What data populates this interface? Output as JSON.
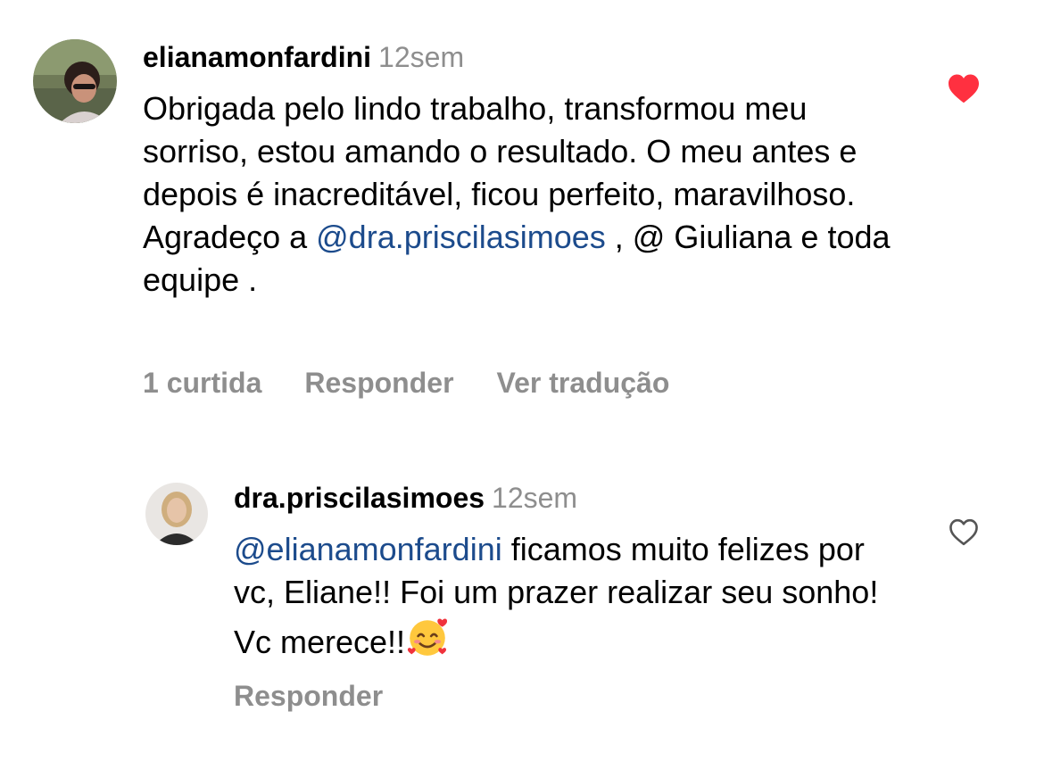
{
  "comments": [
    {
      "username": "elianamonfardini",
      "time": "12sem",
      "text_before": "Obrigada pelo lindo trabalho, transformou meu sorriso, estou amando o resultado. O meu antes e depois é inacreditável, ficou perfeito, maravilhoso. Agradeço a ",
      "mention": "@dra.priscilasimoes",
      "text_after": " , @ Giuliana e toda equipe .",
      "likes": "1 curtida",
      "reply": "Responder",
      "translate": "Ver tradução",
      "liked": true,
      "like_color": "#ff3040",
      "like_icon": "heart-filled-icon"
    },
    {
      "username": "dra.priscilasimoes",
      "time": "12sem",
      "mention": "@elianamonfardini",
      "text_after": " ficamos muito felizes por vc, Eliane!! Foi um prazer realizar seu sonho! Vc merece!!",
      "emoji": "smiling-face-with-hearts-emoji",
      "reply": "Responder",
      "liked": false,
      "like_icon": "heart-outline-icon"
    }
  ],
  "colors": {
    "mention": "#1c4b8c",
    "muted": "#8e8e8e"
  }
}
